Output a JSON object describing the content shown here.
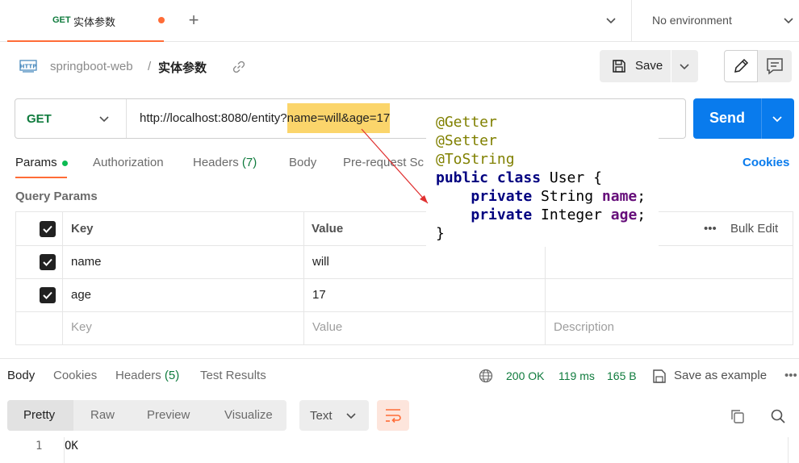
{
  "tab": {
    "method": "GET",
    "name": "实体参数"
  },
  "environment": {
    "label": "No environment"
  },
  "breadcrumb": {
    "collection": "springboot-web",
    "separator": "/",
    "request": "实体参数"
  },
  "toolbar": {
    "save_label": "Save"
  },
  "request": {
    "method": "GET",
    "url_base": "http://localhost:8080/entity?",
    "url_query": "name=will&age=17",
    "send_label": "Send"
  },
  "request_tabs": {
    "params": "Params",
    "authorization": "Authorization",
    "headers": "Headers",
    "headers_count": "(7)",
    "body": "Body",
    "prerequest": "Pre-request Sc",
    "cookies": "Cookies"
  },
  "query_params": {
    "title": "Query Params",
    "columns": {
      "key": "Key",
      "value": "Value",
      "bulk_edit": "Bulk Edit"
    },
    "rows": [
      {
        "key": "name",
        "value": "will",
        "checked": true
      },
      {
        "key": "age",
        "value": "17",
        "checked": true
      }
    ],
    "placeholders": {
      "key": "Key",
      "value": "Value",
      "description": "Description"
    }
  },
  "code_popup": {
    "ann1": "@Getter",
    "ann2": "@Setter",
    "ann3": "@ToString",
    "l4_kw": "public class",
    "l4_rest": " User {",
    "l5_kw": "private",
    "l5_type": " String ",
    "l5_field": "name",
    "l5_end": ";",
    "l6_kw": "private",
    "l6_type": " Integer ",
    "l6_field": "age",
    "l6_end": ";",
    "l7": "}"
  },
  "response": {
    "tabs": {
      "body": "Body",
      "cookies": "Cookies",
      "headers": "Headers",
      "headers_count": "(5)",
      "test_results": "Test Results"
    },
    "status": "200 OK",
    "time": "119 ms",
    "size": "165 B",
    "save_example": "Save as example",
    "more": "•••",
    "views": {
      "pretty": "Pretty",
      "raw": "Raw",
      "preview": "Preview",
      "visualize": "Visualize"
    },
    "format": "Text",
    "line_number": "1",
    "line_text": "OK"
  },
  "colors": {
    "accent": "#ff6c37",
    "primary": "#097bed",
    "method_get": "#0f7b3d",
    "highlight": "#fbd56b",
    "arrow": "#e03030"
  }
}
